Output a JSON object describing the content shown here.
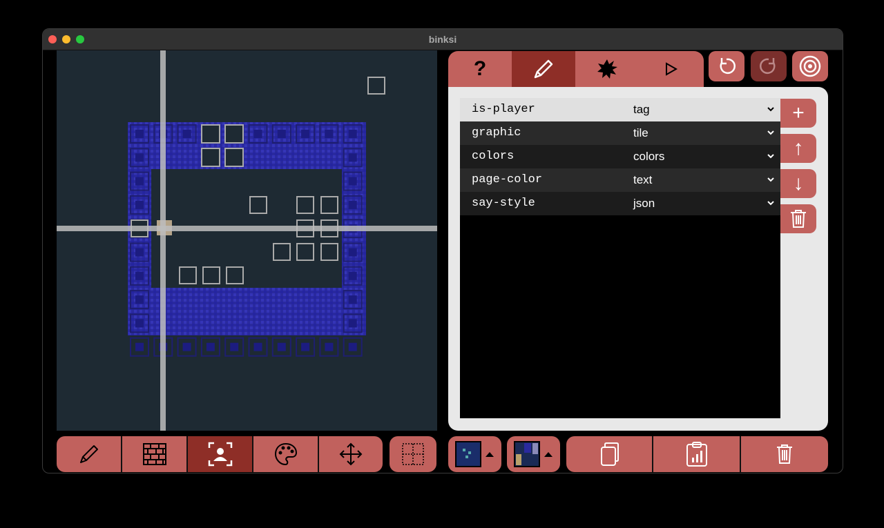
{
  "window": {
    "title": "binksi"
  },
  "top_tabs": [
    {
      "name": "help",
      "label": "?"
    },
    {
      "name": "edit",
      "label": "pencil",
      "active": true
    },
    {
      "name": "events",
      "label": "splat"
    },
    {
      "name": "play",
      "label": "▷"
    }
  ],
  "history_buttons": [
    "undo",
    "redo",
    "record"
  ],
  "components": [
    {
      "name": "is-player",
      "type": "tag"
    },
    {
      "name": "graphic",
      "type": "tile"
    },
    {
      "name": "colors",
      "type": "colors"
    },
    {
      "name": "page-color",
      "type": "text"
    },
    {
      "name": "say-style",
      "type": "json"
    }
  ],
  "side_buttons": [
    "+",
    "↑",
    "↓",
    "trash"
  ],
  "bottom_tools": [
    "pencil-icon",
    "brick-wall-icon",
    "user-frame-icon",
    "palette-icon",
    "move-arrows-icon",
    "grid-select-icon"
  ],
  "bottom_actions": [
    "copy-icon",
    "clipboard-chart-icon",
    "trash-icon"
  ],
  "colors": {
    "accent": "#c1615d",
    "accent_active": "#8e2e27",
    "scene_bg": "#1e2a33",
    "tile_blue": "#2a2a9e",
    "panel_bg": "#e8e8e8"
  }
}
